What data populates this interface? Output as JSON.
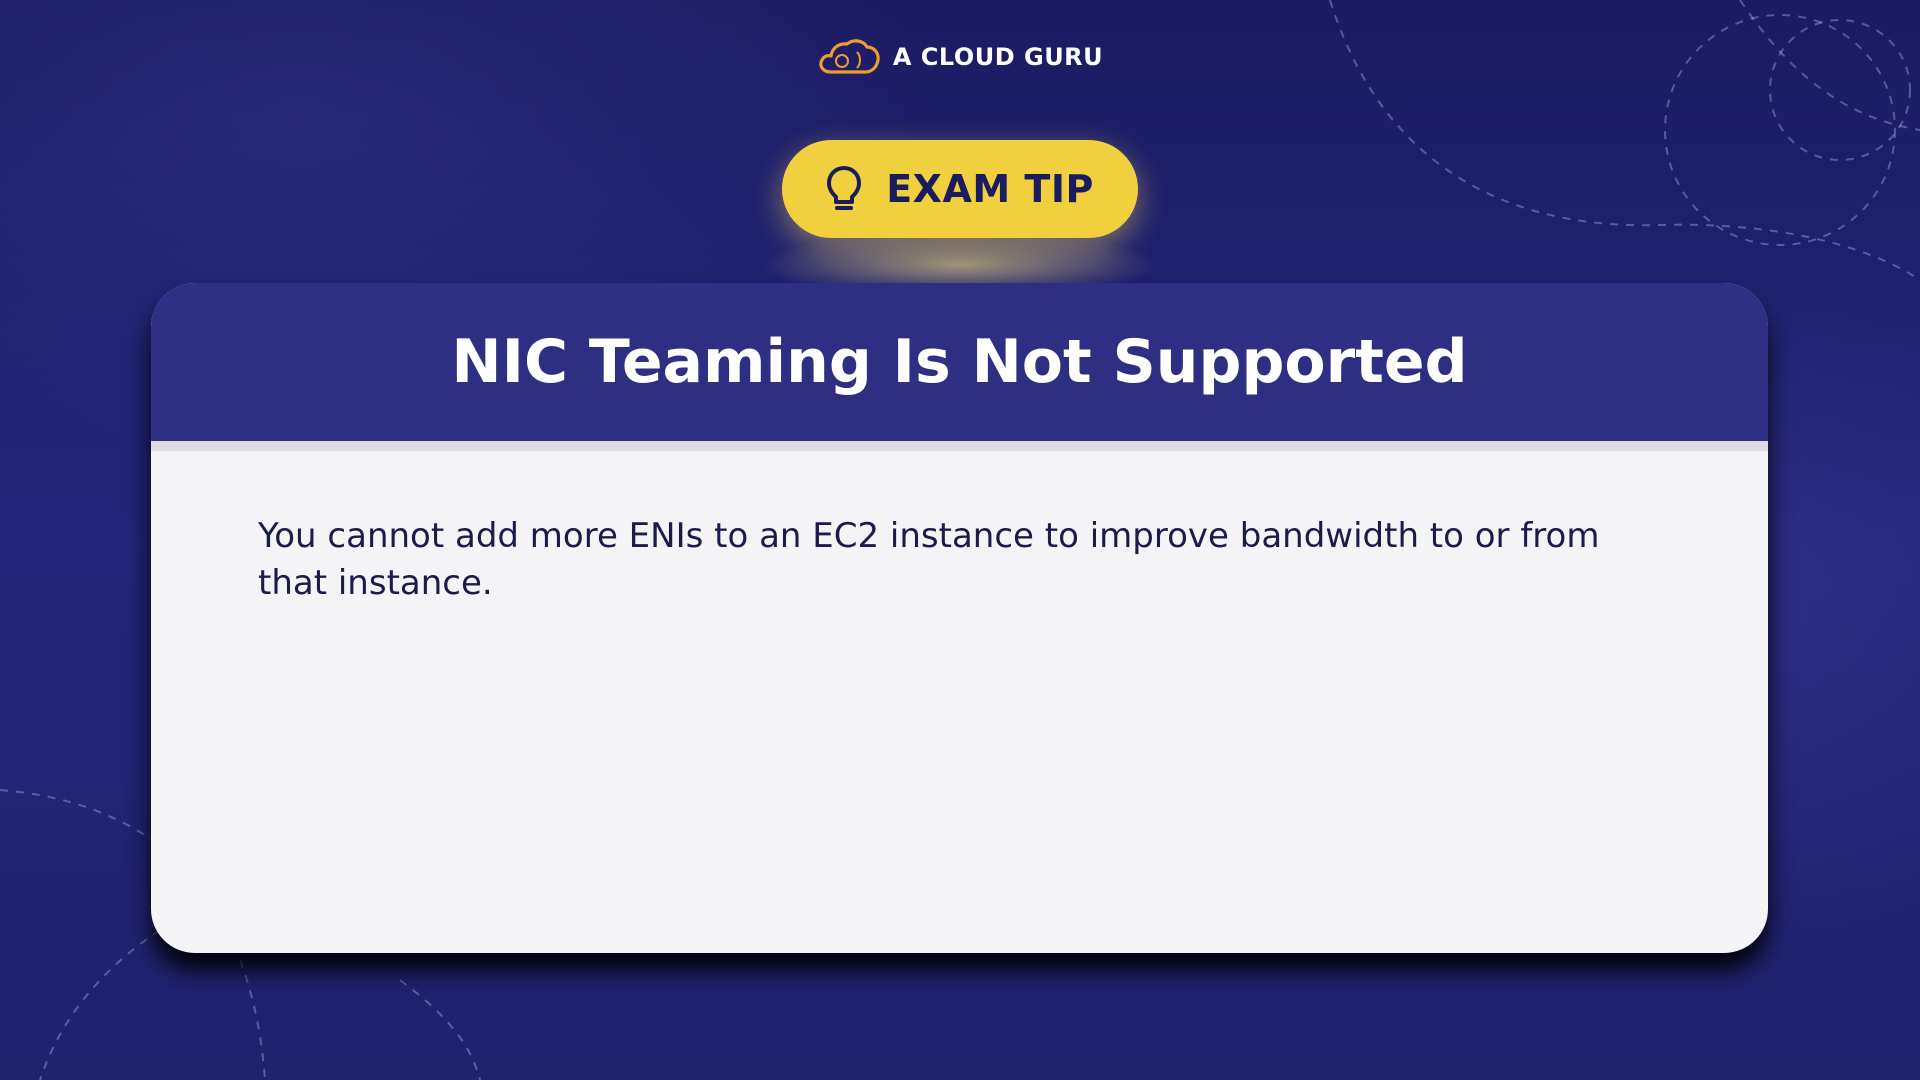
{
  "brand": {
    "name": "A CLOUD GURU",
    "logo_icon": "cloud-icon",
    "logo_color": "#f29a2e"
  },
  "badge": {
    "label": "EXAM TIP",
    "icon": "lightbulb-icon",
    "color": "#f1d040"
  },
  "card": {
    "title": "NIC Teaming Is Not Supported",
    "body": "You cannot add more ENIs to an EC2 instance to improve bandwidth to or from that instance.",
    "header_color": "#2e2e82"
  },
  "colors": {
    "background": "#1f206e",
    "text_dark": "#1b1c4a"
  }
}
